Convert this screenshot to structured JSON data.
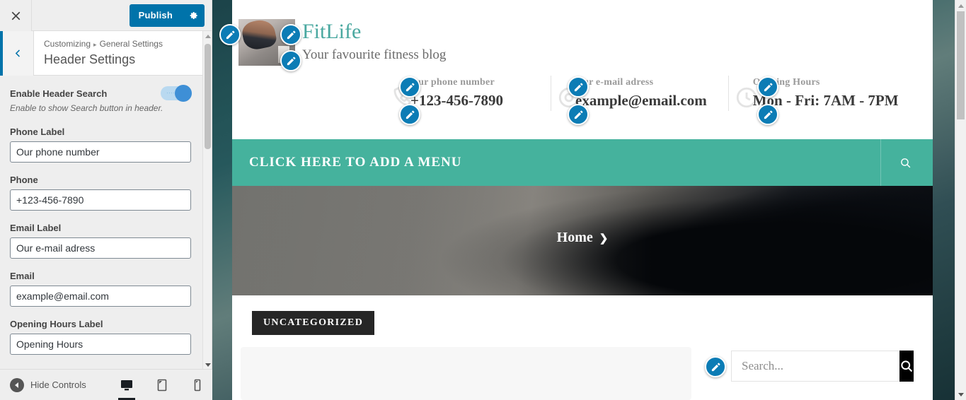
{
  "customizer": {
    "close_icon": "close-icon",
    "publish_label": "Publish",
    "gear_icon": "gear-icon",
    "back_icon": "chevron-left-icon",
    "breadcrumb_root": "Customizing",
    "breadcrumb_separator": "▸",
    "breadcrumb_section": "General Settings",
    "panel_title": "Header Settings",
    "accent_color": "#0073aa",
    "controls": [
      {
        "type": "toggle",
        "label": "Enable Header Search",
        "description": "Enable to show Search button in header.",
        "value": "on"
      },
      {
        "type": "text",
        "label": "Phone Label",
        "value": "Our phone number"
      },
      {
        "type": "text",
        "label": "Phone",
        "value": "+123-456-7890"
      },
      {
        "type": "text",
        "label": "Email Label",
        "value": "Our e-mail adress"
      },
      {
        "type": "text",
        "label": "Email",
        "value": "example@email.com"
      },
      {
        "type": "text",
        "label": "Opening Hours Label",
        "value": "Opening Hours"
      }
    ],
    "footer": {
      "hide_controls_label": "Hide Controls",
      "devices": [
        {
          "name": "desktop",
          "icon": "desktop-icon",
          "active": true
        },
        {
          "name": "tablet",
          "icon": "tablet-icon",
          "active": false
        },
        {
          "name": "mobile",
          "icon": "mobile-icon",
          "active": false
        }
      ]
    }
  },
  "preview": {
    "site_title": "FitLife",
    "site_tagline": "Your favourite fitness blog",
    "title_color": "#4aa8a0",
    "contacts": [
      {
        "icon": "phone-icon",
        "label": "Our phone number",
        "value": "+123-456-7890"
      },
      {
        "icon": "email-icon",
        "label": "Our e-mail adress",
        "value": "example@email.com"
      },
      {
        "icon": "clock-icon",
        "label": "Opening Hours",
        "value": "Mon - Fri: 7AM - 7PM"
      }
    ],
    "menu": {
      "cta_label": "CLICK HERE TO ADD A MENU",
      "bar_color": "#45b29d",
      "search_icon": "search-icon"
    },
    "hero": {
      "breadcrumb_label": "Home",
      "breadcrumb_chevron": "❯"
    },
    "content": {
      "category_badge": "UNCATEGORIZED",
      "search_placeholder": "Search...",
      "search_submit_icon": "search-icon"
    }
  }
}
